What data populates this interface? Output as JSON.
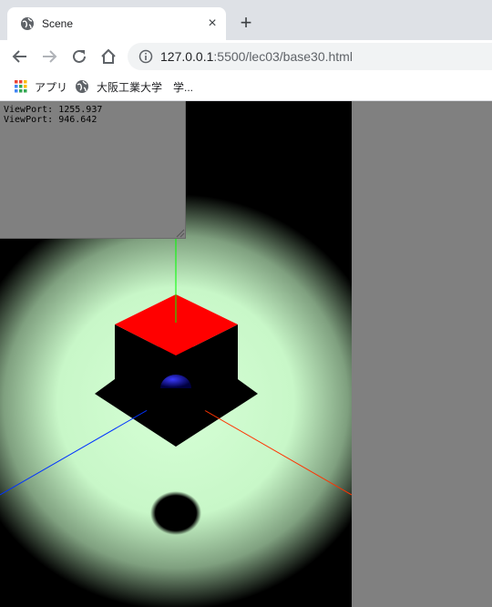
{
  "browser": {
    "tab_title": "Scene",
    "tab_close": "×",
    "new_tab": "+",
    "url_host": "127.0.0.1",
    "url_path": ":5500/lec03/base30.html",
    "bookmarks": [
      {
        "label": "アプリ",
        "icon": "apps-grid-icon"
      },
      {
        "label": "大阪工業大学　学...",
        "icon": "globe-icon"
      }
    ]
  },
  "page": {
    "viewport_lines": [
      "ViewPort: 1255.937",
      "ViewPort: 946.642"
    ]
  },
  "colors": {
    "background": "#808080",
    "cube_top": "#ff0000",
    "y_axis": "#00ff00",
    "x_axis": "#ff3300",
    "z_axis": "#0033ff",
    "spotlight": "#ccffcc"
  }
}
